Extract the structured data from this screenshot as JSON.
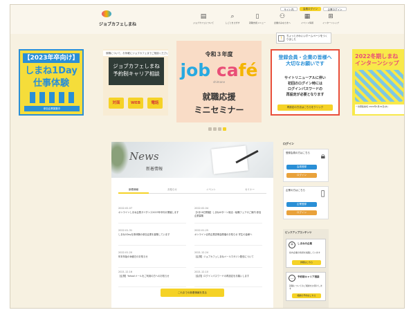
{
  "header": {
    "site_name": "ジョブカフェしまね",
    "nav": [
      {
        "icon": "building-icon",
        "glyph": "▤",
        "label": "ジョブカフェについて"
      },
      {
        "icon": "search-icon",
        "glyph": "⌕",
        "label": "しごとをさがす"
      },
      {
        "icon": "document-icon",
        "glyph": "▯",
        "label": "就職支援メニュー"
      },
      {
        "icon": "people-icon",
        "glyph": "⚇",
        "label": "企業のみなさまへ"
      },
      {
        "icon": "calendar-icon",
        "glyph": "▦",
        "label": "イベント情報"
      },
      {
        "icon": "map-icon",
        "glyph": "⊞",
        "label": "インターンシップ"
      }
    ],
    "top_buttons": [
      "サイト内",
      "会員ログイン",
      "企業ログイン"
    ]
  },
  "notice": {
    "text": "ちょっとかわいいホームページをつくりました"
  },
  "slides": [
    {
      "tag": "【2023年卒向け】",
      "line1": "しまね1Day",
      "line2": "仕事体験",
      "foot": "参加企業募集中"
    },
    {
      "strip": "就職について、お気軽にジョブカフェまでご相談ください",
      "board": [
        "ジョブカフェしまね",
        "予約制キャリア相談"
      ],
      "pills": [
        "対面",
        "WEB",
        "電話"
      ]
    },
    {
      "era": "令和３年度",
      "brand": [
        "job",
        " ca",
        "fé"
      ],
      "sub": "shimane",
      "line1": "就職応援",
      "line2": "ミニセミナー"
    },
    {
      "title": [
        "登録会員・企業の皆様へ",
        "大切なお願いです"
      ],
      "body": [
        "サイトリニューアルに伴い",
        "初回のログイン時には",
        "ログインパスワードの",
        "再設定が必要となります"
      ],
      "cta": "再設定の方法はこちらをクリック"
    },
    {
      "title": [
        "2022冬期しまね",
        "インターンシップ"
      ],
      "foot": "一次募集締切 2022年1月19日(水)"
    }
  ],
  "carousel": {
    "count": 4,
    "active": 3
  },
  "news": {
    "script": "News",
    "title": "新着情報",
    "tabs": [
      "新着情報",
      "お知らせ",
      "イベント",
      "セミナー"
    ],
    "items": [
      {
        "date": "2022.02.07",
        "text": "オンラインしまね企業ガイダンス2023年卒向け開催します"
      },
      {
        "date": "2022.02.04",
        "text": "【2月18日開催】しまねUIターン就活・転職フェアのご案内 参加企業募集"
      },
      {
        "date": "2022.01.31",
        "text": "しまね1Day仕事体験の参加企業を募集しています"
      },
      {
        "date": "2022.01.25",
        "text": "オンライン合同企業説明会開催のお知らせ 学生の皆様へ"
      },
      {
        "date": "2022.01.20",
        "text": "年末年始の休館日のお知らせ"
      },
      {
        "date": "2021.12.24",
        "text": "【企業】ジョブカフェしまねメールマガジン配信について"
      },
      {
        "date": "2021.12.16",
        "text": "【企業】Yahoo!メールをご利用の方へのお知らせ"
      },
      {
        "date": "2021.12.10",
        "text": "【会員】ログインパスワードの再設定をお願いします"
      }
    ],
    "more": "これまでの新着情報を見る"
  },
  "login": {
    "heading": "ログイン",
    "member_title": "登録会員の方はこちら",
    "member_buttons": [
      "会員登録",
      "ログイン"
    ],
    "company_title": "企業の方はこちら",
    "company_buttons": [
      "企業登録",
      "ログイン"
    ]
  },
  "pickup": {
    "heading": "ピックアップコンテンツ",
    "cards": [
      {
        "icon": "＊",
        "title": "しまねの企業",
        "desc": "県内企業の情報を掲載しています",
        "button": "詳細はこちら"
      },
      {
        "icon": "…",
        "title": "予約制キャリア相談",
        "desc": "就職についてのご相談をお受けします",
        "button": "相談の予約はこちら"
      }
    ]
  },
  "colors": {
    "accent": "#f5d226",
    "blue": "#2a8fd6",
    "orange": "#e9a23b",
    "background": "#f7f1e1"
  }
}
